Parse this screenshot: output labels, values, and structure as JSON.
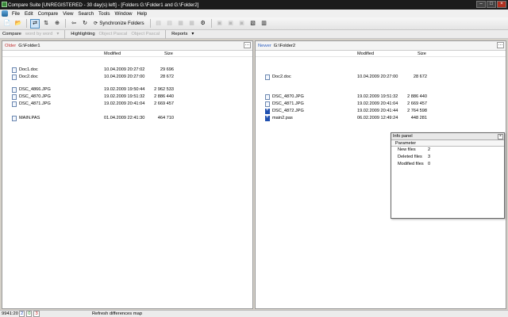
{
  "window": {
    "title": "Compare Suite [UNREGISTERED - 30 day(s) left] - [Folders G:\\Folder1 and G:\\Folder2]"
  },
  "menu": [
    "File",
    "Edit",
    "Compare",
    "View",
    "Search",
    "Tools",
    "Window",
    "Help"
  ],
  "toolbar": {
    "sync_label": "Synchronize Folders"
  },
  "toolbar2": {
    "compare": "Compare",
    "word_by_word": "word by word",
    "highlighting": "Highlighting",
    "object_pascal_1": "Object Pascal",
    "object_pascal_2": "Object Pascal",
    "reports": "Reports"
  },
  "left_panel": {
    "tag": "Older",
    "path": "G:\\Folder1",
    "columns": {
      "modified": "Modified",
      "size": "Size"
    },
    "files": [
      {
        "name": "Doc1.doc",
        "modified": "10.04.2009 20:27:02",
        "size": "29 696",
        "icon": "doc-icon"
      },
      {
        "name": "Doc2.doc",
        "modified": "10.04.2009 20:27:00",
        "size": "28 672",
        "icon": "doc-icon"
      },
      {
        "name": "DSC_4866.JPG",
        "modified": "19.02.2009 19:50:44",
        "size": "2 962 533",
        "icon": "image-icon"
      },
      {
        "name": "DSC_4870.JPG",
        "modified": "19.02.2009 19:51:32",
        "size": "2 886 440",
        "icon": "image-icon"
      },
      {
        "name": "DSC_4871.JPG",
        "modified": "19.02.2009 20:41:04",
        "size": "2 669 457",
        "icon": "image-icon"
      },
      {
        "name": "",
        "modified": "",
        "size": "",
        "icon": ""
      },
      {
        "name": "MAIN.PAS",
        "modified": "01.04.2009 22:41:30",
        "size": "464 710",
        "icon": "doc-icon"
      }
    ]
  },
  "right_panel": {
    "tag": "Newer",
    "path": "G:\\Folder2",
    "columns": {
      "modified": "Modified",
      "size": "Size"
    },
    "files": [
      {
        "name": "",
        "modified": "",
        "size": "",
        "icon": ""
      },
      {
        "name": "Doc2.doc",
        "modified": "10.04.2009 20:27:00",
        "size": "28 672",
        "icon": "doc-icon"
      },
      {
        "name": "",
        "modified": "",
        "size": "",
        "icon": ""
      },
      {
        "name": "DSC_4870.JPG",
        "modified": "19.02.2009 19:51:32",
        "size": "2 886 440",
        "icon": "image-icon"
      },
      {
        "name": "DSC_4871.JPG",
        "modified": "19.02.2009 20:41:04",
        "size": "2 669 457",
        "icon": "image-icon"
      },
      {
        "name": "DSC_4872.JPG",
        "modified": "19.02.2009 20:41:44",
        "size": "2 764 598",
        "icon": "new-file-icon"
      },
      {
        "name": "main2.pas",
        "modified": "06.02.2009 12:49:24",
        "size": "448 281",
        "icon": "new-file-icon"
      }
    ]
  },
  "info_panel": {
    "title": "Info panel",
    "header": "Parameter",
    "rows": [
      {
        "key": "New files",
        "value": "2"
      },
      {
        "key": "Deleted files",
        "value": "3"
      },
      {
        "key": "Modified files",
        "value": "0"
      }
    ]
  },
  "status": {
    "position": "9941:20",
    "counts": [
      "2",
      "0",
      "3"
    ],
    "count_colors": [
      "#2050c0",
      "#209020",
      "#c02020"
    ],
    "refresh": "Refresh differences map"
  }
}
